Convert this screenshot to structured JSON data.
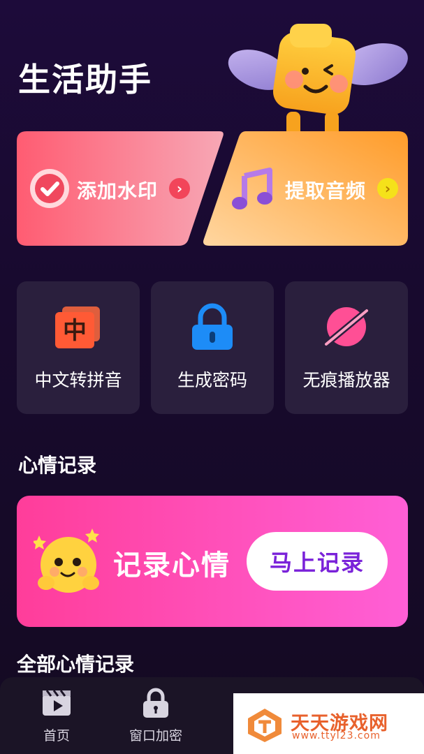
{
  "page": {
    "title": "生活助手"
  },
  "features": {
    "watermark": {
      "label": "添加水印",
      "arrow": "›",
      "icon": "check-badge-icon",
      "accent": "#f2455a"
    },
    "audio": {
      "label": "提取音频",
      "arrow": "›",
      "icon": "music-note-icon",
      "accent": "#f5e11a"
    }
  },
  "tools": [
    {
      "label": "中文转拼音",
      "icon": "chinese-char-icon",
      "glyph": "中"
    },
    {
      "label": "生成密码",
      "icon": "lock-icon"
    },
    {
      "label": "无痕播放器",
      "icon": "planet-icon"
    }
  ],
  "mood": {
    "section_title": "心情记录",
    "banner_title": "记录心情",
    "button_label": "马上记录",
    "all_records_title": "全部心情记录"
  },
  "nav": [
    {
      "label": "首页",
      "icon": "clapperboard-icon"
    },
    {
      "label": "窗口加密",
      "icon": "lock-icon"
    }
  ],
  "watermark_overlay": {
    "title": "天天游戏网",
    "url": "www.ttyl23.com"
  },
  "colors": {
    "background": "#1d0b3a",
    "tile": "#2a1f3d",
    "mood_banner": "#ff4fb8",
    "button_text": "#7a22d9"
  }
}
